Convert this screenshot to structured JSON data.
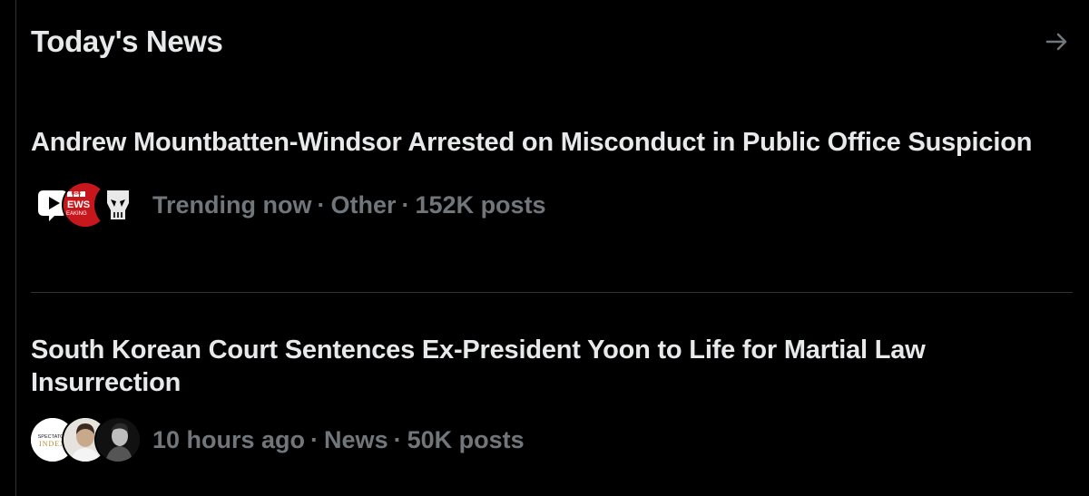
{
  "section": {
    "title": "Today's News"
  },
  "stories": [
    {
      "headline": "Andrew Mountbatten-Windsor Arrested on Misconduct in Public Office Suspicion",
      "time": "Trending now",
      "category": "Other",
      "posts": "152K posts",
      "avatars": [
        "play-logo",
        "bbc-news-breaking-logo",
        "skull-logo"
      ],
      "avatar_texts": {
        "bbc_line1": "BBC",
        "bbc_line2": "EWS",
        "bbc_line3": "EAKING"
      }
    },
    {
      "headline": "South Korean Court Sentences Ex-President Yoon to Life for Martial Law Insurrection",
      "time": "10 hours ago",
      "category": "News",
      "posts": "50K posts",
      "avatars": [
        "spectator-index-logo",
        "person-avatar",
        "portrait-avatar"
      ],
      "avatar_texts": {
        "spectator_line1": "SPECTATOR",
        "spectator_line2": "INDEX"
      }
    }
  ],
  "separator": "·",
  "colors": {
    "background": "#000000",
    "primary_text": "#e7e9ea",
    "secondary_text": "#71767b",
    "divider": "#2f3336",
    "bbc_red": "#c8161d"
  }
}
